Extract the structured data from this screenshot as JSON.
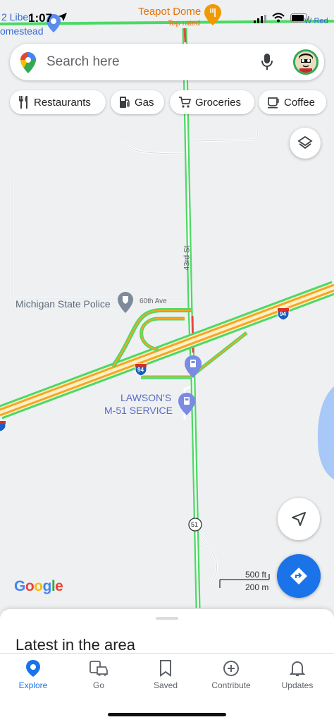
{
  "status_bar": {
    "time": "1:07"
  },
  "search": {
    "placeholder": "Search here"
  },
  "chips": [
    {
      "label": "Restaurants",
      "icon": "fork-knife-icon"
    },
    {
      "label": "Gas",
      "icon": "gas-pump-icon"
    },
    {
      "label": "Groceries",
      "icon": "cart-icon"
    },
    {
      "label": "Coffee",
      "icon": "coffee-cup-icon"
    }
  ],
  "map": {
    "top_place": "Teapot Dome",
    "top_place_tag": "Top rated",
    "top_left_1": "2 Liber",
    "top_left_2": "omestead",
    "top_right": "W Red",
    "road_43rd": "43rd St",
    "road_60th": "60th Ave",
    "police": "Michigan State Police",
    "lawsons_1": "LAWSON'S",
    "lawsons_2": "M-51 SERVICE",
    "i94_shield": "94",
    "m51_shield": "51"
  },
  "scale": {
    "ft": "500 ft",
    "m": "200 m"
  },
  "logo": "Google",
  "sheet": {
    "title": "Latest in the area"
  },
  "nav": [
    {
      "label": "Explore",
      "active": true
    },
    {
      "label": "Go"
    },
    {
      "label": "Saved"
    },
    {
      "label": "Contribute"
    },
    {
      "label": "Updates"
    }
  ],
  "colors": {
    "traffic_green": "#4cd964",
    "traffic_orange": "#f5a623",
    "traffic_red": "#e8453c",
    "accent_blue": "#1a73e8",
    "water": "#a8c8f8"
  }
}
